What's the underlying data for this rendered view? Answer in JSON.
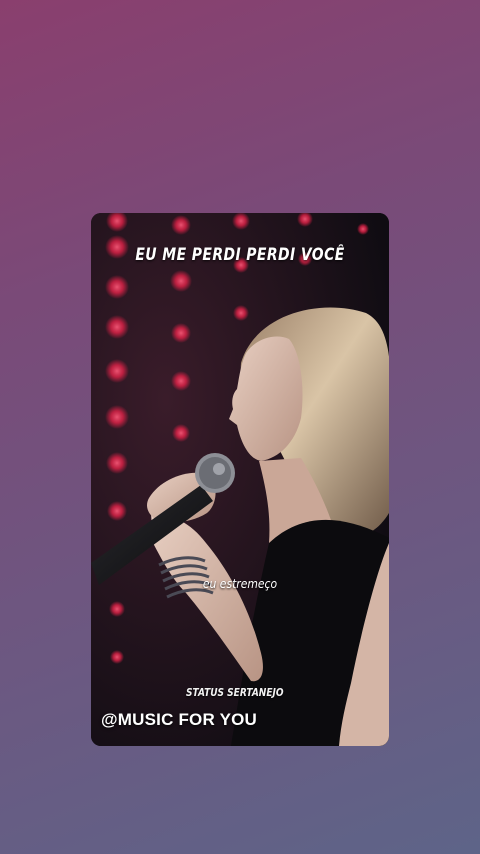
{
  "story": {
    "title": "EU ME PERDI PERDI VOCÊ",
    "caption": "eu estremeço",
    "brand": "STATUS SERTANEJO",
    "handle": "@MUSIC FOR YOU"
  },
  "colors": {
    "background_top": "#8a3f6e",
    "background_bottom": "#5e6488",
    "stage_lights": "#e8234a",
    "card_background": "#130f16"
  }
}
